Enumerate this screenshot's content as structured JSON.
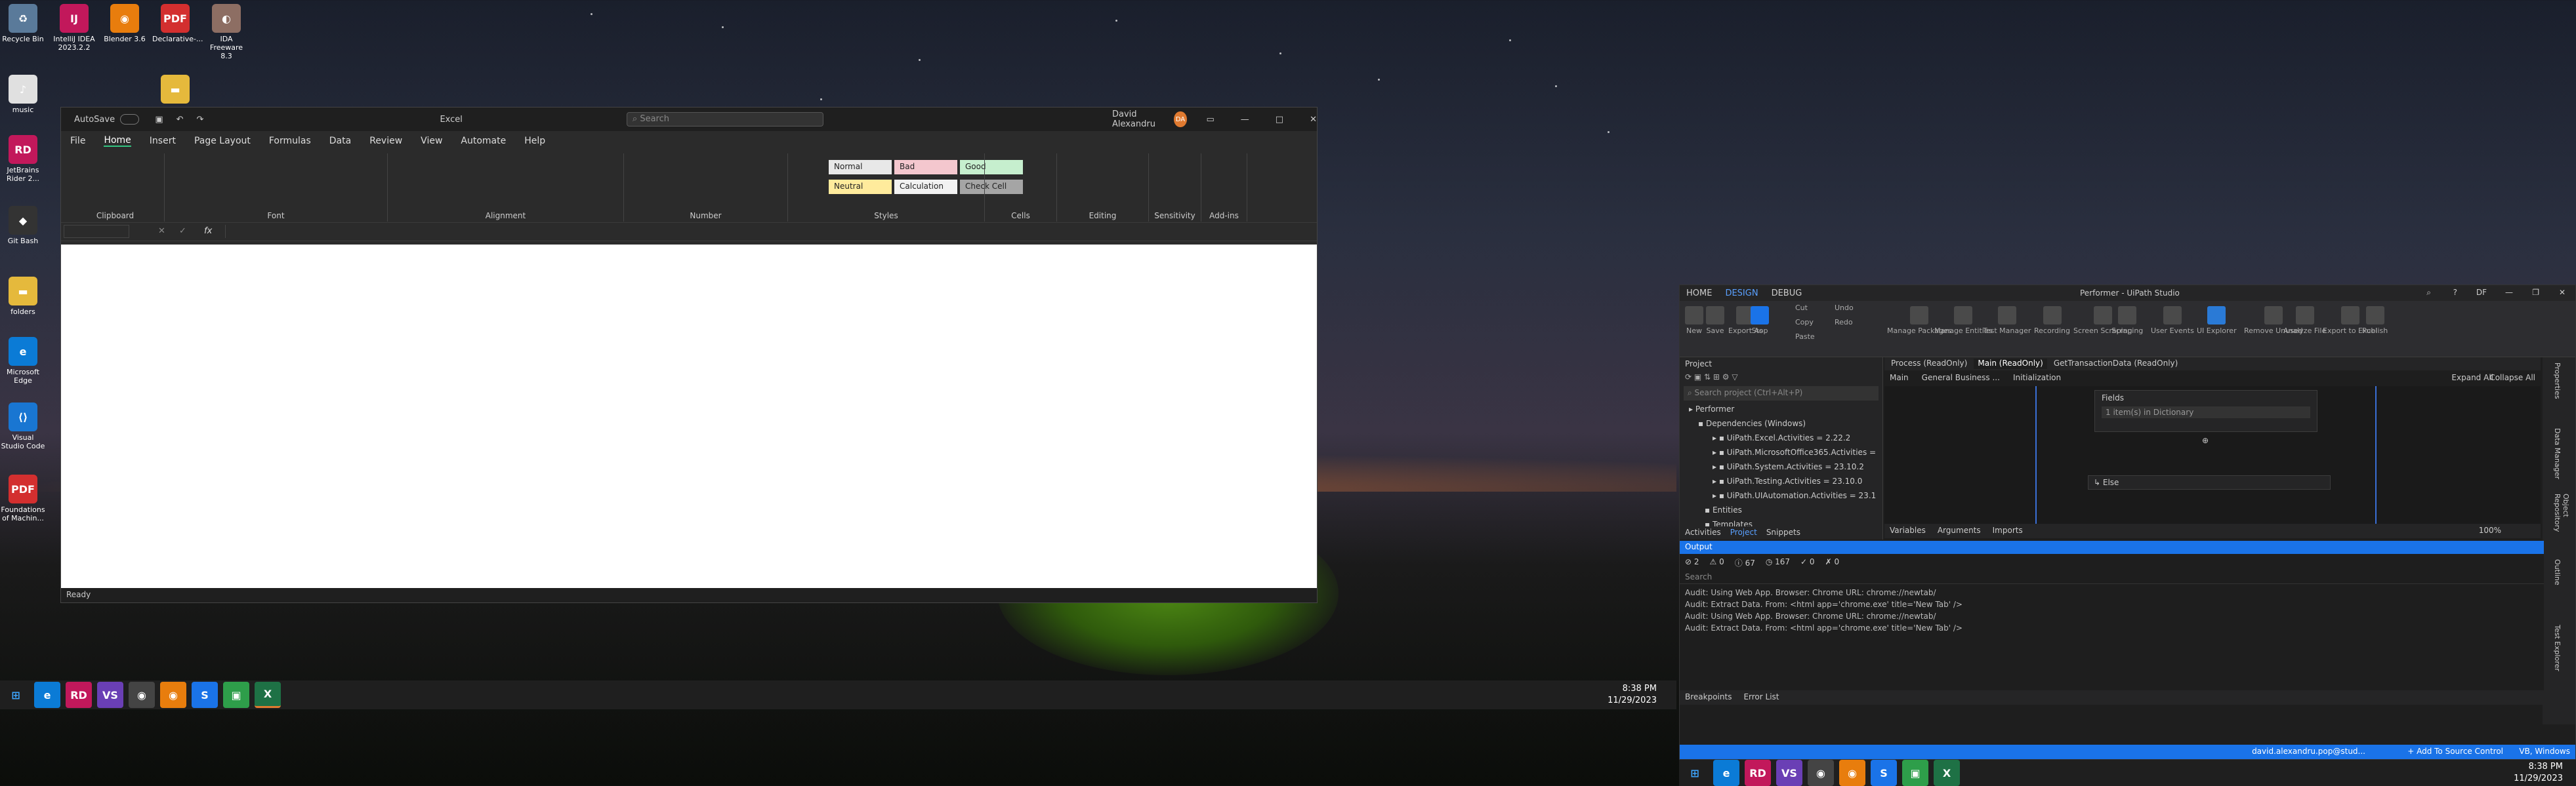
{
  "desktop": {
    "icons": [
      {
        "label": "Recycle Bin",
        "color": "#5a7a9a",
        "glyph": "♻"
      },
      {
        "label": "IntelliJ IDEA 2023.2.2",
        "color": "#c2185b",
        "glyph": "IJ"
      },
      {
        "label": "Blender 3.6",
        "color": "#e87d0d",
        "glyph": "◉"
      },
      {
        "label": "Declarative-...",
        "color": "#d32f2f",
        "glyph": "PDF"
      },
      {
        "label": "IDA Freeware 8.3",
        "color": "#8d6e63",
        "glyph": "◐"
      },
      {
        "label": "music",
        "color": "#e0e0e0",
        "glyph": "♪"
      },
      {
        "label": "folders",
        "color": "#e5b93c",
        "glyph": "▬"
      },
      {
        "label": "JetBrains Rider 2...",
        "color": "#c2185b",
        "glyph": "RD"
      },
      {
        "label": "Git Bash",
        "color": "#333",
        "glyph": "◆"
      },
      {
        "label": "folders",
        "color": "#e5b93c",
        "glyph": "▬"
      },
      {
        "label": "Microsoft Edge",
        "color": "#0b7bd6",
        "glyph": "e"
      },
      {
        "label": "Visual Studio Code",
        "color": "#1976d2",
        "glyph": "⟨⟩"
      },
      {
        "label": "Foundations of Machin...",
        "color": "#d32f2f",
        "glyph": "PDF"
      }
    ]
  },
  "excel": {
    "title": "Excel",
    "autosave": "AutoSave",
    "search_placeholder": "Search",
    "user": "David Alexandru",
    "user_initials": "DA",
    "menu": [
      "File",
      "Home",
      "Insert",
      "Page Layout",
      "Formulas",
      "Data",
      "Review",
      "View",
      "Automate",
      "Help"
    ],
    "groups": [
      "Clipboard",
      "Font",
      "Alignment",
      "Number",
      "Styles",
      "Cells",
      "Editing",
      "Sensitivity",
      "Add-ins"
    ],
    "styles": [
      {
        "label": "Normal",
        "bg": "#e8e8e8"
      },
      {
        "label": "Bad",
        "bg": "#f4c7ce"
      },
      {
        "label": "Good",
        "bg": "#c6efce"
      },
      {
        "label": "Neutral",
        "bg": "#ffeb9c"
      },
      {
        "label": "Calculation",
        "bg": "#f2f2f2"
      },
      {
        "label": "Check Cell",
        "bg": "#a5a5a5"
      }
    ],
    "status": "Ready",
    "fx": "fx"
  },
  "uipath": {
    "tabs": [
      "HOME",
      "DESIGN",
      "DEBUG"
    ],
    "title": "Performer - UiPath Studio",
    "user": "DF",
    "ribbon": [
      "New",
      "Save",
      "Export As",
      "Stop",
      "Cut",
      "Copy",
      "Paste",
      "Undo",
      "Redo",
      "Manage Packages",
      "Manage Entities",
      "Test Manager",
      "Recording",
      "Screen Scraping",
      "Scraping",
      "User Events",
      "UI Explorer",
      "Remove Unused",
      "Analyze File",
      "Export to Excel",
      "Publish"
    ],
    "project_label": "Project",
    "doc_tabs": [
      "Process (ReadOnly)",
      "Main (ReadOnly)",
      "GetTransactionData (ReadOnly)"
    ],
    "breadcrumb": [
      "Main",
      "General Business ...",
      "Initialization"
    ],
    "expand_all": "Expand All",
    "collapse_all": "Collapse All",
    "search_project": "Search project (Ctrl+Alt+P)",
    "tree": [
      "Performer",
      "Dependencies (Windows)",
      "UiPath.Excel.Activities = 2.22.2",
      "UiPath.MicrosoftOffice365.Activities =",
      "UiPath.System.Activities = 23.10.2",
      "UiPath.Testing.Activities = 23.10.0",
      "UiPath.UIAutomation.Activities = 23.1",
      "Entities",
      "Templates"
    ],
    "fields_label": "Fields",
    "fields_value": "1 item(s) in Dictionary",
    "else_label": "Else",
    "bottom_tabs": [
      "Activities",
      "Project",
      "Snippets"
    ],
    "var_tabs": [
      "Variables",
      "Arguments",
      "Imports"
    ],
    "zoom": "100%",
    "output_label": "Output",
    "output_counts": [
      "2",
      "0",
      "67",
      "167",
      "0",
      "0"
    ],
    "output_search": "Search",
    "output_lines": [
      "Audit: Using Web App. Browser: Chrome URL: chrome://newtab/",
      "Audit: Extract Data. From: <html app='chrome.exe' title='New Tab' />",
      "Audit: Using Web App. Browser: Chrome URL: chrome://newtab/",
      "Audit: Extract Data. From: <html app='chrome.exe' title='New Tab' />"
    ],
    "footer_tabs": [
      "Breakpoints",
      "Error List"
    ],
    "status_user": "david.alexandru.pop@stud...",
    "source_control": "+ Add To Source Control",
    "platform": "VB, Windows",
    "side_tabs": [
      "Properties",
      "Data Manager",
      "Object Repository",
      "Outline",
      "Test Explorer"
    ]
  },
  "taskbar_left": {
    "time": "8:38 PM",
    "date": "11/29/2023"
  },
  "taskbar_right": {
    "time": "8:38 PM",
    "date": "11/29/2023"
  }
}
